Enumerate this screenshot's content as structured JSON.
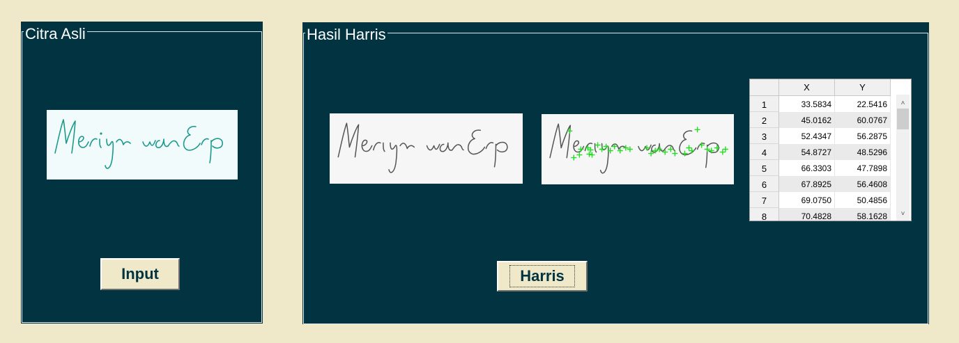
{
  "left_panel": {
    "title": "Citra Asli",
    "image_label": "Merijn van Erp",
    "button_label": "Input"
  },
  "right_panel": {
    "title": "Hasil Harris",
    "gray_image_label": "Merijn van Erp",
    "corner_image_label": "Merijn van Erp",
    "button_label": "Harris",
    "table": {
      "columns": [
        "X",
        "Y"
      ],
      "rows": [
        {
          "index": "1",
          "x": "33.5834",
          "y": "22.5416"
        },
        {
          "index": "2",
          "x": "45.0162",
          "y": "60.0767"
        },
        {
          "index": "3",
          "x": "52.4347",
          "y": "56.2875"
        },
        {
          "index": "4",
          "x": "54.8727",
          "y": "48.5296"
        },
        {
          "index": "5",
          "x": "66.3303",
          "y": "47.7898"
        },
        {
          "index": "6",
          "x": "67.8925",
          "y": "56.4608"
        },
        {
          "index": "7",
          "x": "69.0750",
          "y": "50.4856"
        },
        {
          "index": "8",
          "x": "70.4828",
          "y": "58.1628"
        }
      ]
    }
  },
  "colors": {
    "background": "#efe9ca",
    "panel": "#013440",
    "signature_teal": "#1a9a8c",
    "signature_gray": "#555555",
    "marker_green": "#22dd22"
  }
}
